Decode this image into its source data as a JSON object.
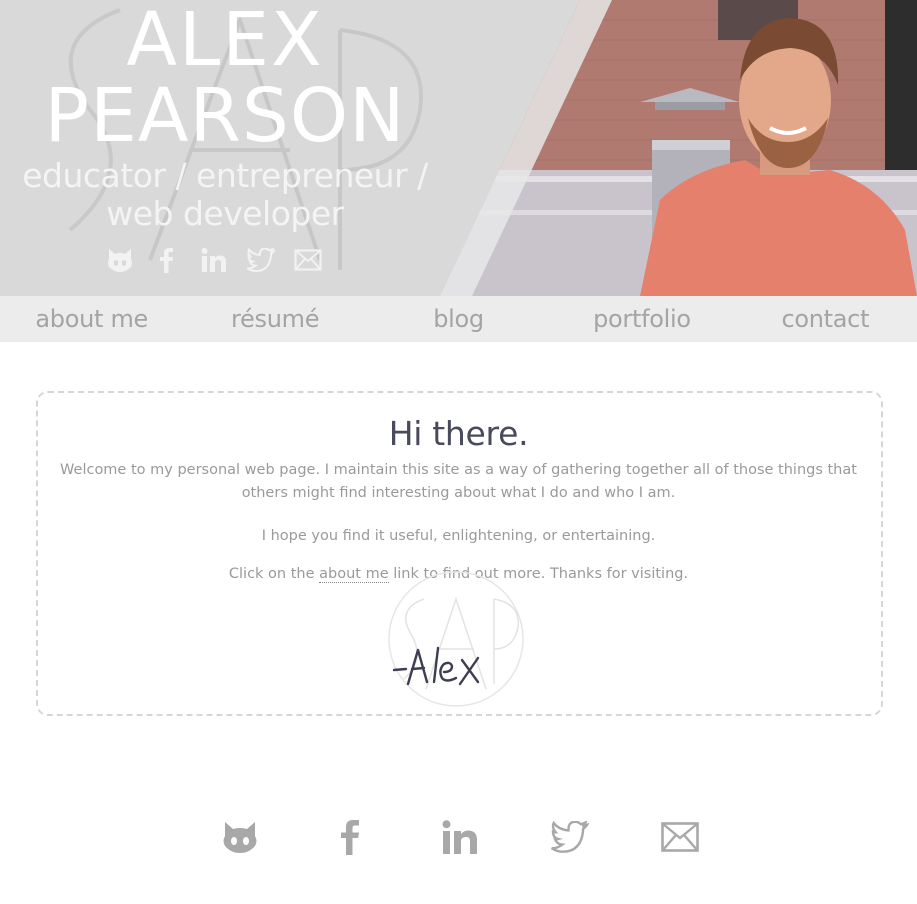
{
  "header": {
    "name_line_1": "ALEX",
    "name_line_2": "PEARSON",
    "tagline_line_1": "educator / entrepreneur /",
    "tagline_line_2": "web developer",
    "social_icons": [
      "github-icon",
      "facebook-icon",
      "linkedin-icon",
      "twitter-icon",
      "email-icon"
    ]
  },
  "nav": {
    "items": [
      {
        "label": "about me"
      },
      {
        "label": "résumé"
      },
      {
        "label": "blog"
      },
      {
        "label": "portfolio"
      },
      {
        "label": "contact"
      }
    ]
  },
  "main": {
    "title": "Hi there.",
    "paragraph_1": "Welcome to my personal web page. I maintain this site as a way of gathering together all of those things that others might find interesting about what I do and who I am.",
    "paragraph_2": "I hope you find it useful, enlightening, or entertaining.",
    "paragraph_3_before": "Click on the ",
    "paragraph_3_link": "about me",
    "paragraph_3_after": " link to find out more. Thanks for visiting.",
    "signature": "-Alex"
  },
  "footer": {
    "social_icons": [
      "github-icon",
      "facebook-icon",
      "linkedin-icon",
      "twitter-icon",
      "email-icon"
    ]
  },
  "colors": {
    "nav_background": "#ececec",
    "nav_text": "#a4a4a4",
    "title_text": "#4a4a5e",
    "body_text": "#9a9a9a",
    "icon_gray": "#a8a8a8",
    "header_overlay": "#d9d9d9"
  }
}
